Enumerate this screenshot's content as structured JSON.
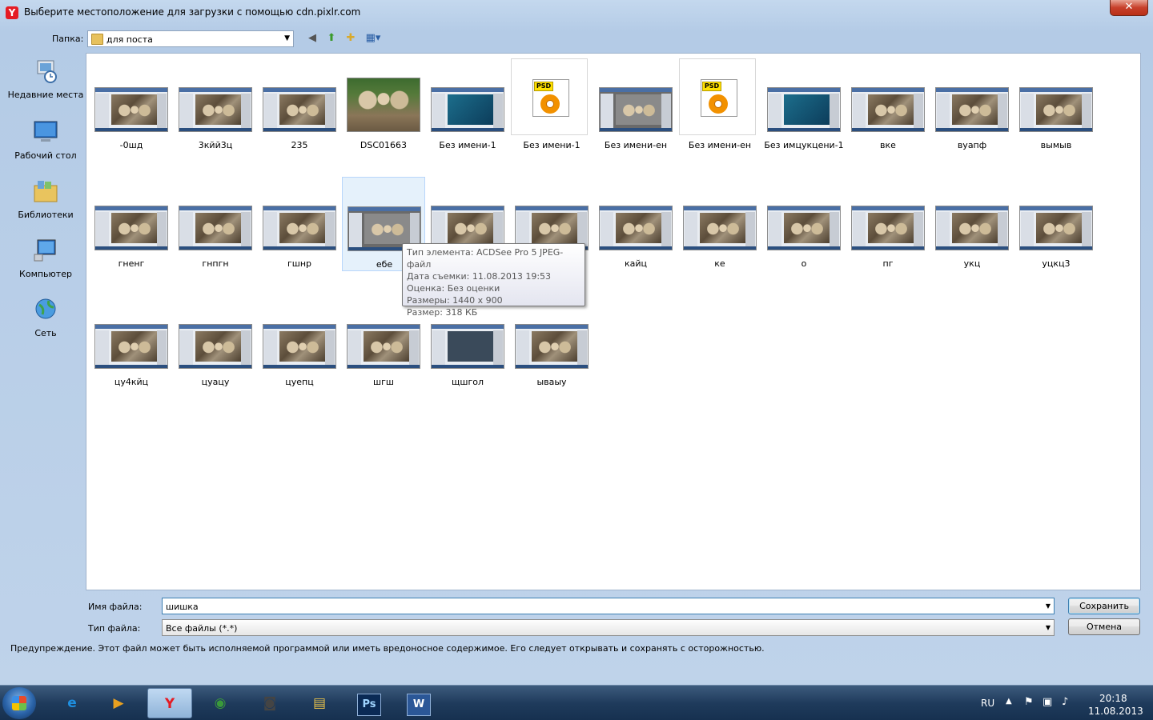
{
  "dialog": {
    "title": "Выберите местоположение для загрузки с помощью cdn.pixlr.com",
    "app_icon": "Y",
    "close_glyph": "✕"
  },
  "toolbar": {
    "folder_label": "Папка:",
    "folder_value": "для поста"
  },
  "places": [
    {
      "label": "Недавние места",
      "icon": "recent-places-icon"
    },
    {
      "label": "Рабочий стол",
      "icon": "desktop-icon"
    },
    {
      "label": "Библиотеки",
      "icon": "libraries-icon"
    },
    {
      "label": "Компьютер",
      "icon": "computer-icon"
    },
    {
      "label": "Сеть",
      "icon": "network-icon"
    }
  ],
  "files": [
    {
      "name": "-0шд",
      "kind": "screen"
    },
    {
      "name": "3кйй3ц",
      "kind": "screen"
    },
    {
      "name": "235",
      "kind": "screen"
    },
    {
      "name": "DSC01663",
      "kind": "photo"
    },
    {
      "name": "Без имени-1",
      "kind": "express"
    },
    {
      "name": "Без имени-1",
      "kind": "psd"
    },
    {
      "name": "Без имени-ен",
      "kind": "gray"
    },
    {
      "name": "Без имени-ен",
      "kind": "psd"
    },
    {
      "name": "Без имцукцени-1",
      "kind": "express"
    },
    {
      "name": "вке",
      "kind": "screen"
    },
    {
      "name": "вуапф",
      "kind": "screen"
    },
    {
      "name": "вымыв",
      "kind": "screen"
    },
    {
      "name": "гненг",
      "kind": "screen"
    },
    {
      "name": "гнпгн",
      "kind": "screen"
    },
    {
      "name": "гшнр",
      "kind": "screen"
    },
    {
      "name": "ебе",
      "kind": "gray",
      "selected": true
    },
    {
      "name": "",
      "kind": "screen"
    },
    {
      "name": "",
      "kind": "screen"
    },
    {
      "name": "кайц",
      "kind": "screen"
    },
    {
      "name": "ке",
      "kind": "screen"
    },
    {
      "name": "о",
      "kind": "screen"
    },
    {
      "name": "пг",
      "kind": "screen"
    },
    {
      "name": "укц",
      "kind": "screen"
    },
    {
      "name": "уцкц3",
      "kind": "screen"
    },
    {
      "name": "цу4кйц",
      "kind": "screen"
    },
    {
      "name": "цуацу",
      "kind": "screen"
    },
    {
      "name": "цуепц",
      "kind": "screen"
    },
    {
      "name": "шгш",
      "kind": "screen"
    },
    {
      "name": "щшгол",
      "kind": "dark"
    },
    {
      "name": "ываыу",
      "kind": "screen"
    }
  ],
  "tooltip": {
    "type": "Тип элемента: ACDSee Pro 5 JPEG-файл",
    "date": "Дата съемки: 11.08.2013 19:53",
    "rating": "Оценка: Без оценки",
    "dimensions": "Размеры: 1440 x 900",
    "size": "Размер: 318 КБ"
  },
  "form": {
    "filename_label": "Имя файла:",
    "filename_value": "шишка",
    "filetype_label": "Тип файла:",
    "filetype_value": "Все файлы (*.*)",
    "save_label": "Сохранить",
    "cancel_label": "Отмена",
    "warning": "Предупреждение. Этот файл может быть исполняемой программой или иметь вредоносное содержимое. Его следует открывать и сохранять с осторожностью."
  },
  "taskbar": {
    "apps": [
      {
        "name": "internet-explorer",
        "glyph": "e"
      },
      {
        "name": "media-player",
        "glyph": "▶"
      },
      {
        "name": "yandex-browser",
        "glyph": "Y",
        "active": true
      },
      {
        "name": "chrome",
        "glyph": "◉"
      },
      {
        "name": "camera-app",
        "glyph": "◙"
      },
      {
        "name": "file-explorer",
        "glyph": "▤"
      },
      {
        "name": "photoshop",
        "glyph": "Ps"
      },
      {
        "name": "word",
        "glyph": "W"
      }
    ],
    "lang": "RU",
    "time": "20:18",
    "date": "11.08.2013"
  },
  "colors": {
    "accent": "#3c7fb1",
    "selection": "#e5f1fb",
    "taskbar": "#1f3b5c"
  }
}
